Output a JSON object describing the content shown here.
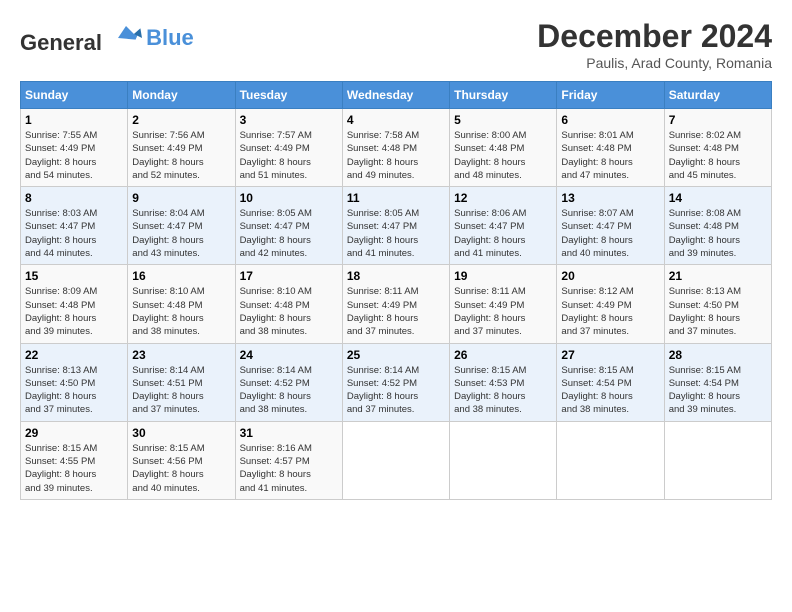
{
  "header": {
    "logo_line1": "General",
    "logo_line2": "Blue",
    "month_title": "December 2024",
    "location": "Paulis, Arad County, Romania"
  },
  "days_of_week": [
    "Sunday",
    "Monday",
    "Tuesday",
    "Wednesday",
    "Thursday",
    "Friday",
    "Saturday"
  ],
  "weeks": [
    [
      {
        "day": "1",
        "info": "Sunrise: 7:55 AM\nSunset: 4:49 PM\nDaylight: 8 hours\nand 54 minutes."
      },
      {
        "day": "2",
        "info": "Sunrise: 7:56 AM\nSunset: 4:49 PM\nDaylight: 8 hours\nand 52 minutes."
      },
      {
        "day": "3",
        "info": "Sunrise: 7:57 AM\nSunset: 4:49 PM\nDaylight: 8 hours\nand 51 minutes."
      },
      {
        "day": "4",
        "info": "Sunrise: 7:58 AM\nSunset: 4:48 PM\nDaylight: 8 hours\nand 49 minutes."
      },
      {
        "day": "5",
        "info": "Sunrise: 8:00 AM\nSunset: 4:48 PM\nDaylight: 8 hours\nand 48 minutes."
      },
      {
        "day": "6",
        "info": "Sunrise: 8:01 AM\nSunset: 4:48 PM\nDaylight: 8 hours\nand 47 minutes."
      },
      {
        "day": "7",
        "info": "Sunrise: 8:02 AM\nSunset: 4:48 PM\nDaylight: 8 hours\nand 45 minutes."
      }
    ],
    [
      {
        "day": "8",
        "info": "Sunrise: 8:03 AM\nSunset: 4:47 PM\nDaylight: 8 hours\nand 44 minutes."
      },
      {
        "day": "9",
        "info": "Sunrise: 8:04 AM\nSunset: 4:47 PM\nDaylight: 8 hours\nand 43 minutes."
      },
      {
        "day": "10",
        "info": "Sunrise: 8:05 AM\nSunset: 4:47 PM\nDaylight: 8 hours\nand 42 minutes."
      },
      {
        "day": "11",
        "info": "Sunrise: 8:05 AM\nSunset: 4:47 PM\nDaylight: 8 hours\nand 41 minutes."
      },
      {
        "day": "12",
        "info": "Sunrise: 8:06 AM\nSunset: 4:47 PM\nDaylight: 8 hours\nand 41 minutes."
      },
      {
        "day": "13",
        "info": "Sunrise: 8:07 AM\nSunset: 4:47 PM\nDaylight: 8 hours\nand 40 minutes."
      },
      {
        "day": "14",
        "info": "Sunrise: 8:08 AM\nSunset: 4:48 PM\nDaylight: 8 hours\nand 39 minutes."
      }
    ],
    [
      {
        "day": "15",
        "info": "Sunrise: 8:09 AM\nSunset: 4:48 PM\nDaylight: 8 hours\nand 39 minutes."
      },
      {
        "day": "16",
        "info": "Sunrise: 8:10 AM\nSunset: 4:48 PM\nDaylight: 8 hours\nand 38 minutes."
      },
      {
        "day": "17",
        "info": "Sunrise: 8:10 AM\nSunset: 4:48 PM\nDaylight: 8 hours\nand 38 minutes."
      },
      {
        "day": "18",
        "info": "Sunrise: 8:11 AM\nSunset: 4:49 PM\nDaylight: 8 hours\nand 37 minutes."
      },
      {
        "day": "19",
        "info": "Sunrise: 8:11 AM\nSunset: 4:49 PM\nDaylight: 8 hours\nand 37 minutes."
      },
      {
        "day": "20",
        "info": "Sunrise: 8:12 AM\nSunset: 4:49 PM\nDaylight: 8 hours\nand 37 minutes."
      },
      {
        "day": "21",
        "info": "Sunrise: 8:13 AM\nSunset: 4:50 PM\nDaylight: 8 hours\nand 37 minutes."
      }
    ],
    [
      {
        "day": "22",
        "info": "Sunrise: 8:13 AM\nSunset: 4:50 PM\nDaylight: 8 hours\nand 37 minutes."
      },
      {
        "day": "23",
        "info": "Sunrise: 8:14 AM\nSunset: 4:51 PM\nDaylight: 8 hours\nand 37 minutes."
      },
      {
        "day": "24",
        "info": "Sunrise: 8:14 AM\nSunset: 4:52 PM\nDaylight: 8 hours\nand 38 minutes."
      },
      {
        "day": "25",
        "info": "Sunrise: 8:14 AM\nSunset: 4:52 PM\nDaylight: 8 hours\nand 37 minutes."
      },
      {
        "day": "26",
        "info": "Sunrise: 8:15 AM\nSunset: 4:53 PM\nDaylight: 8 hours\nand 38 minutes."
      },
      {
        "day": "27",
        "info": "Sunrise: 8:15 AM\nSunset: 4:54 PM\nDaylight: 8 hours\nand 38 minutes."
      },
      {
        "day": "28",
        "info": "Sunrise: 8:15 AM\nSunset: 4:54 PM\nDaylight: 8 hours\nand 39 minutes."
      }
    ],
    [
      {
        "day": "29",
        "info": "Sunrise: 8:15 AM\nSunset: 4:55 PM\nDaylight: 8 hours\nand 39 minutes."
      },
      {
        "day": "30",
        "info": "Sunrise: 8:15 AM\nSunset: 4:56 PM\nDaylight: 8 hours\nand 40 minutes."
      },
      {
        "day": "31",
        "info": "Sunrise: 8:16 AM\nSunset: 4:57 PM\nDaylight: 8 hours\nand 41 minutes."
      },
      {
        "day": "",
        "info": ""
      },
      {
        "day": "",
        "info": ""
      },
      {
        "day": "",
        "info": ""
      },
      {
        "day": "",
        "info": ""
      }
    ]
  ]
}
